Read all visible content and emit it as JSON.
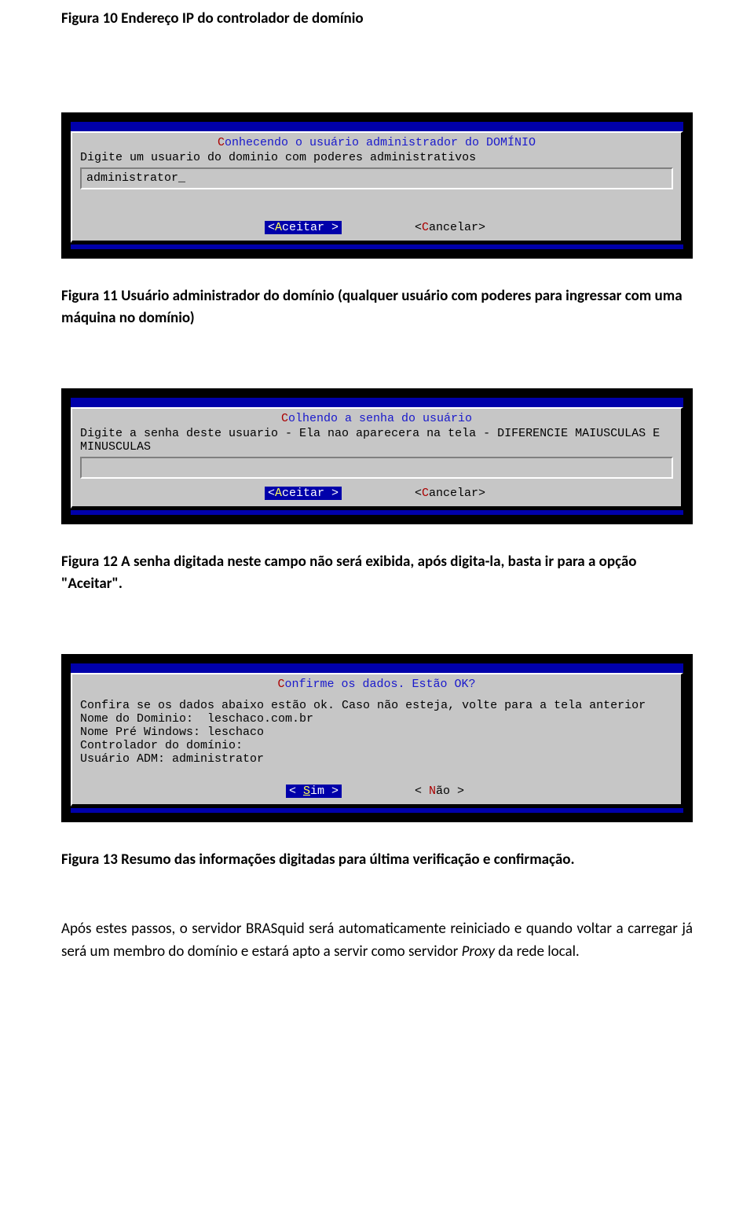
{
  "captions": {
    "fig10": "Figura 10 Endereço IP do controlador de domínio",
    "fig11": "Figura 11 Usuário administrador do domínio (qualquer usuário com poderes para ingressar com uma máquina no domínio)",
    "fig12": "Figura 12 A senha digitada neste campo não será exibida, após digita-la, basta ir para a opção \"Aceitar\".",
    "fig13": "Figura 13 Resumo das informações digitadas para última verificação e confirmação.",
    "final": "Após estes passos, o servidor BRASquid será automaticamente reiniciado e quando voltar a carregar já será um membro do domínio e estará apto a servir como servidor ",
    "final_em": "Proxy",
    "final2": " da rede local."
  },
  "dialog1": {
    "title_pre": "C",
    "title_rest": "onhecendo o usuário administrador do DOMÍNIO",
    "prompt": "Digite um usuario do dominio com poderes administrativos",
    "input": "administrator_",
    "accept": "<Aceitar >",
    "cancel": "<Cancelar>"
  },
  "dialog2": {
    "title_pre": "C",
    "title_rest": "olhendo a senha do usuário",
    "prompt": "Digite a senha deste usuario - Ela nao aparecera na tela - DIFERENCIE MAIUSCULAS E MINUSCULAS",
    "input": "",
    "accept": "<Aceitar >",
    "cancel": "<Cancelar>"
  },
  "dialog3": {
    "title_pre": "C",
    "title_rest": "onfirme os dados. Estão OK?",
    "body": "Confira se os dados abaixo estão ok. Caso não esteja, volte para a tela anterior\nNome do Dominio:  leschaco.com.br\nNome Pré Windows: leschaco\nControlador do domínio:\nUsuário ADM: administrator",
    "yes": "<  Sim  >",
    "no": "<  Não  >"
  }
}
